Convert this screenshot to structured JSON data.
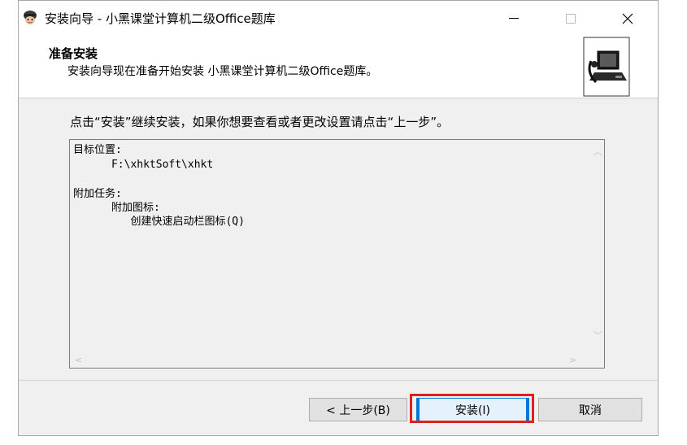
{
  "window": {
    "title": "安装向导 - 小黑课堂计算机二级Office题库",
    "controls": {
      "minimize": "—",
      "maximize": "☐",
      "close": "✕"
    }
  },
  "header": {
    "title": "准备安装",
    "subtitle": "安装向导现在准备开始安装 小黑课堂计算机二级Office题库。",
    "image_icon": "computer-install-icon"
  },
  "instruction": "点击“安装”继续安装，如果你想要查看或者更改设置请点击“上一步”。",
  "memo": {
    "lines": [
      "目标位置:",
      "      F:\\xhktSoft\\xhkt",
      "",
      "附加任务:",
      "      附加图标:",
      "         创建快速启动栏图标(Q)"
    ]
  },
  "buttons": {
    "back": "< 上一步(B)",
    "install": "安装(I)",
    "cancel": "取消"
  },
  "colors": {
    "highlight": "#e02020",
    "accent": "#0078d7",
    "dialog_bg": "#f0f0f0"
  }
}
